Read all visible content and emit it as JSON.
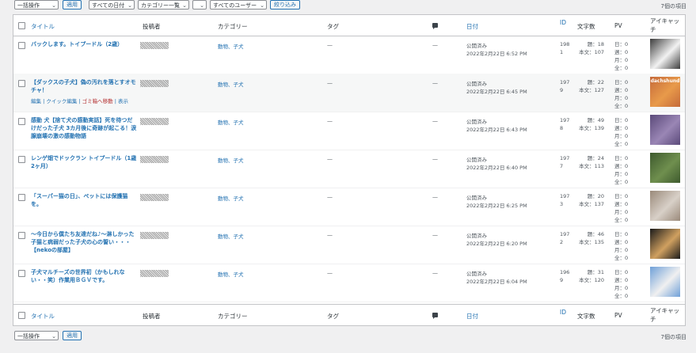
{
  "top": {
    "bulk": "一括操作",
    "apply": "適用",
    "all_dates": "すべての日付",
    "category_list": "カテゴリー一覧",
    "blank_select": "",
    "all_users": "すべてのユーザー",
    "filter": "絞り込み",
    "item_count": "7個の項目"
  },
  "columns": {
    "title": "タイトル",
    "author": "投稿者",
    "category": "カテゴリー",
    "tags": "タグ",
    "date": "日付",
    "id": "ID",
    "word_count": "文字数",
    "pv": "PV",
    "eyecatch": "アイキャッチ"
  },
  "posts": [
    {
      "title": "バックします。トイプードル（2歳）",
      "category": "動物、子犬",
      "tags": "—",
      "comments": "—",
      "status": "公開済み",
      "date": "2022年2月22日 6:52 PM",
      "id_a": "198",
      "id_b": "1",
      "headings": "題：18",
      "body": "本文：107",
      "pv_d": "日：0",
      "pv_w": "週：0",
      "pv_m": "月：0",
      "pv_all": "全：0",
      "thumb": "#3d3d3d",
      "thumb2": "#f2f2f2"
    },
    {
      "title": "【ダックスの子犬】偽の汚れを落とすオモチャ！",
      "category": "動物、子犬",
      "tags": "—",
      "comments": "—",
      "status": "公開済み",
      "date": "2022年2月22日 6:45 PM",
      "id_a": "197",
      "id_b": "9",
      "headings": "題：22",
      "body": "本文：127",
      "pv_d": "日：0",
      "pv_w": "週：0",
      "pv_m": "月：0",
      "pv_all": "全：0",
      "thumb": "#c56a3a",
      "thumb2": "#e89a4a",
      "thumb_text": "dachshund"
    },
    {
      "title": "感動 犬【捨て犬の感動実話】死を待つだけだった子犬 3カ月後に奇跡が起こる！涙腺崩壊の激の感動物語",
      "category": "動物、子犬",
      "tags": "—",
      "comments": "—",
      "status": "公開済み",
      "date": "2022年2月22日 6:43 PM",
      "id_a": "197",
      "id_b": "8",
      "headings": "題：49",
      "body": "本文：139",
      "pv_d": "日：0",
      "pv_w": "週：0",
      "pv_m": "月：0",
      "pv_all": "全：0",
      "thumb": "#5b4a7a",
      "thumb2": "#9a86b5"
    },
    {
      "title": "レンゲ畑でドックラン トイプードル（1歳2ヶ月）",
      "category": "動物、子犬",
      "tags": "—",
      "comments": "—",
      "status": "公開済み",
      "date": "2022年2月22日 6:40 PM",
      "id_a": "197",
      "id_b": "7",
      "headings": "題：24",
      "body": "本文：113",
      "pv_d": "日：0",
      "pv_w": "週：0",
      "pv_m": "月：0",
      "pv_all": "全：0",
      "thumb": "#3e5a2e",
      "thumb2": "#6f8f4e"
    },
    {
      "title": "「スーパー猫の日」、ペットには保護猫を。",
      "category": "動物、子犬",
      "tags": "—",
      "comments": "—",
      "status": "公開済み",
      "date": "2022年2月22日 6:25 PM",
      "id_a": "197",
      "id_b": "3",
      "headings": "題：20",
      "body": "本文：137",
      "pv_d": "日：0",
      "pv_w": "週：0",
      "pv_m": "月：0",
      "pv_all": "全：0",
      "thumb": "#9a8a7a",
      "thumb2": "#d8d0c8"
    },
    {
      "title": "〜今日から僕たち友達だね♪〜淋しかった子猫と病弱だった子犬の心の誓い・・・【nekoの部屋】",
      "category": "動物、子犬",
      "tags": "—",
      "comments": "—",
      "status": "公開済み",
      "date": "2022年2月22日 6:20 PM",
      "id_a": "197",
      "id_b": "2",
      "headings": "題：46",
      "body": "本文：135",
      "pv_d": "日：0",
      "pv_w": "週：0",
      "pv_m": "月：0",
      "pv_all": "全：0",
      "thumb": "#1a1a1a",
      "thumb2": "#d0a060"
    },
    {
      "title": "子犬マルチーズの世界初（かもしれない・・笑）作業用ＢＧＶです。",
      "category": "動物、子犬",
      "tags": "—",
      "comments": "—",
      "status": "公開済み",
      "date": "2022年2月22日 6:04 PM",
      "id_a": "196",
      "id_b": "9",
      "headings": "題：31",
      "body": "本文：120",
      "pv_d": "日：0",
      "pv_w": "週：0",
      "pv_m": "月：0",
      "pv_all": "全：0",
      "thumb": "#6fa0d8",
      "thumb2": "#f0f0f0"
    }
  ],
  "row_actions": {
    "edit": "編集",
    "quick_edit": "クイック編集",
    "trash": "ゴミ箱へ移動",
    "view": "表示"
  }
}
